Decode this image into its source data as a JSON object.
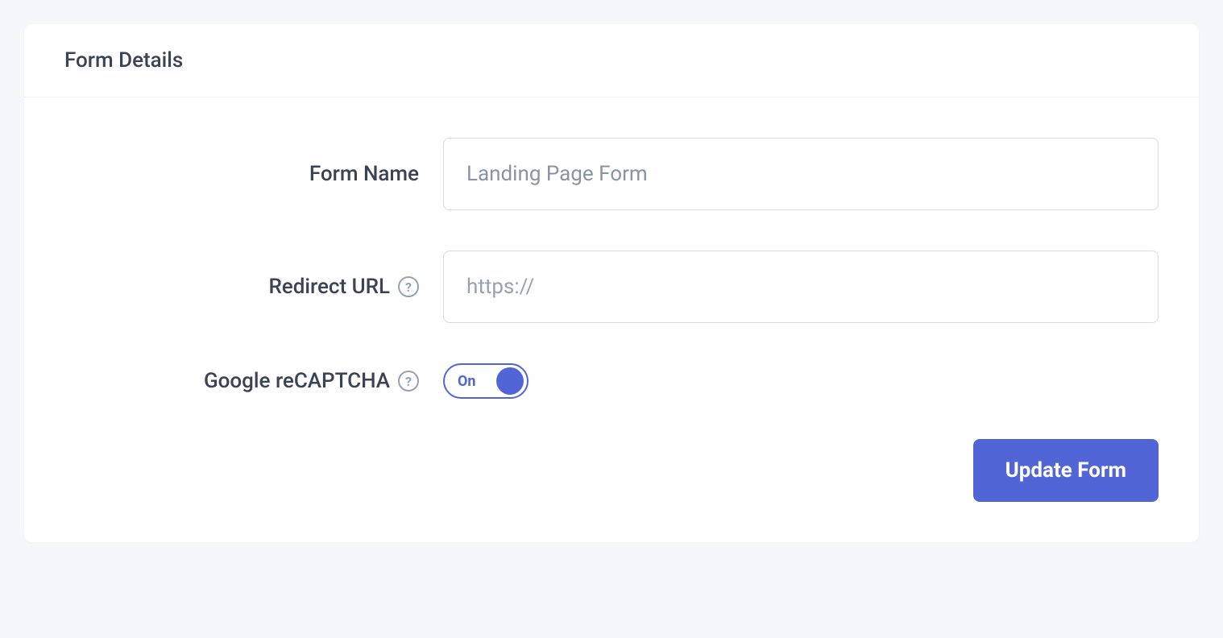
{
  "card": {
    "title": "Form Details"
  },
  "fields": {
    "formName": {
      "label": "Form Name",
      "value": "Landing Page Form"
    },
    "redirectUrl": {
      "label": "Redirect URL",
      "placeholder": "https://",
      "value": ""
    },
    "recaptcha": {
      "label": "Google reCAPTCHA",
      "toggleState": "On"
    }
  },
  "buttons": {
    "update": "Update Form"
  }
}
